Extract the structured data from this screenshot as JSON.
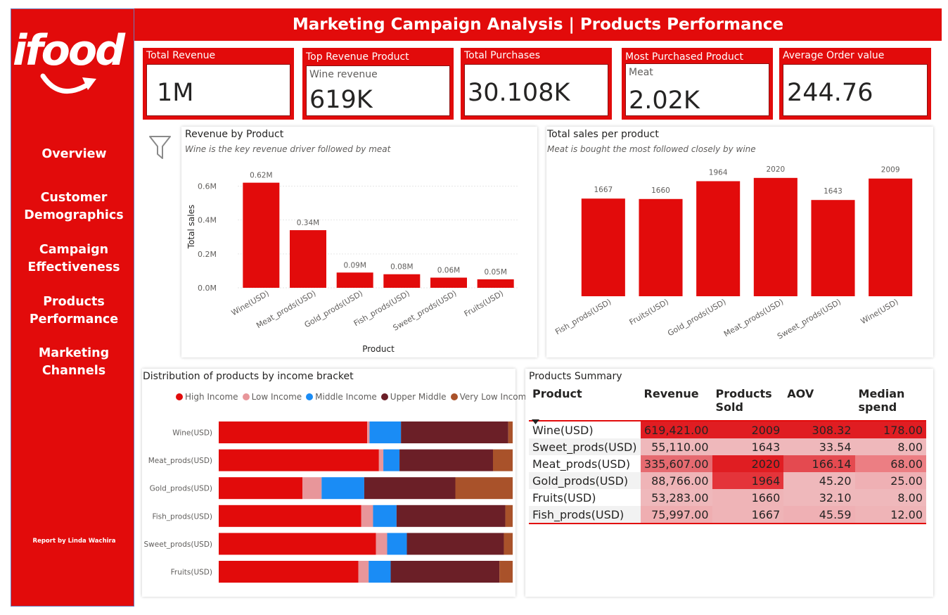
{
  "banner": {
    "title": "Marketing Campaign Analysis | Products Performance"
  },
  "logo": {
    "text": "ifood"
  },
  "nav": {
    "items": [
      {
        "label": "Overview"
      },
      {
        "label": "Customer Demographics"
      },
      {
        "label": "Campaign Effectiveness"
      },
      {
        "label": "Products Performance"
      },
      {
        "label": "Marketing Channels"
      }
    ]
  },
  "credit": "Report by Linda Wachira",
  "kpis": [
    {
      "title": "Total Revenue",
      "value": "1M",
      "sub": ""
    },
    {
      "title": "Top Revenue Product",
      "value": "619K",
      "sub": "Wine revenue"
    },
    {
      "title": "Total Purchases",
      "value": "30.108K",
      "sub": ""
    },
    {
      "title": "Most Purchased Product",
      "value": "2.02K",
      "sub": "Meat"
    },
    {
      "title": "Average Order value",
      "value": "244.76",
      "sub": ""
    }
  ],
  "colors": {
    "brand": "#e20b0b",
    "high": "#e20b0b",
    "low": "#e8969a",
    "middle": "#1a8cf5",
    "upper": "#6b1f27",
    "verylow": "#a9522a"
  },
  "chart_data": [
    {
      "type": "bar",
      "title": "Revenue by Product",
      "subtitle": "Wine is the key revenue driver followed by meat",
      "xlabel": "Product",
      "ylabel": "Total sales",
      "categories": [
        "Wine(USD)",
        "Meat_prods(USD)",
        "Gold_prods(USD)",
        "Fish_prods(USD)",
        "Sweet_prods(USD)",
        "Fruits(USD)"
      ],
      "values": [
        0.62,
        0.34,
        0.09,
        0.08,
        0.06,
        0.05
      ],
      "data_labels": [
        "0.62M",
        "0.34M",
        "0.09M",
        "0.08M",
        "0.06M",
        "0.05M"
      ],
      "yticks": [
        "0.0M",
        "0.2M",
        "0.4M",
        "0.6M"
      ],
      "ytick_values": [
        0,
        0.2,
        0.4,
        0.6
      ],
      "ylim": [
        0,
        0.66
      ],
      "grid": true
    },
    {
      "type": "bar",
      "title": "Total sales per product",
      "subtitle": "Meat is bought the most followed closely by wine",
      "categories": [
        "Fish_prods(USD)",
        "Fruits(USD)",
        "Gold_prods(USD)",
        "Meat_prods(USD)",
        "Sweet_prods(USD)",
        "Wine(USD)"
      ],
      "values": [
        1667,
        1660,
        1964,
        2020,
        1643,
        2009
      ],
      "data_labels": [
        "1667",
        "1660",
        "1964",
        "2020",
        "1643",
        "2009"
      ],
      "ylim": [
        0,
        2150
      ],
      "grid": false
    },
    {
      "type": "bar",
      "orientation": "horizontal-stacked-100",
      "title": "Distribution of products by income bracket",
      "legend_position": "top",
      "categories": [
        "Wine(USD)",
        "Meat_prods(USD)",
        "Gold_prods(USD)",
        "Fish_prods(USD)",
        "Sweet_prods(USD)",
        "Fruits(USD)"
      ],
      "series": [
        {
          "name": "High Income",
          "values": [
            50.5,
            54.5,
            28.5,
            48.5,
            53.5,
            47.5
          ]
        },
        {
          "name": "Low Income",
          "values": [
            0.8,
            1.5,
            6.5,
            4.0,
            3.8,
            3.5
          ]
        },
        {
          "name": "Middle Income",
          "values": [
            10.7,
            5.5,
            14.5,
            8.0,
            6.7,
            7.5
          ]
        },
        {
          "name": "Upper Middle",
          "values": [
            36.5,
            31.8,
            31.0,
            37.0,
            33.0,
            37.0
          ]
        },
        {
          "name": "Very Low Income",
          "values": [
            1.5,
            6.7,
            19.5,
            2.5,
            3.0,
            4.5
          ]
        }
      ]
    },
    {
      "type": "table",
      "title": "Products Summary",
      "columns": [
        "Product",
        "Revenue",
        "Products Sold",
        "AOV",
        "Median spend"
      ],
      "rows": [
        [
          "Wine(USD)",
          "619,421.00",
          "2009",
          "308.32",
          "178.00"
        ],
        [
          "Sweet_prods(USD)",
          "55,110.00",
          "1643",
          "33.54",
          "8.00"
        ],
        [
          "Meat_prods(USD)",
          "335,607.00",
          "2020",
          "166.14",
          "68.00"
        ],
        [
          "Gold_prods(USD)",
          "88,766.00",
          "1964",
          "45.20",
          "25.00"
        ],
        [
          "Fruits(USD)",
          "53,283.00",
          "1660",
          "32.10",
          "8.00"
        ],
        [
          "Fish_prods(USD)",
          "75,997.00",
          "1667",
          "45.59",
          "12.00"
        ]
      ],
      "cell_colors": [
        [
          "#e01d22",
          "#e01d22",
          "#e01d22",
          "#e01d22"
        ],
        [
          "#efb8bb",
          "#efb8bb",
          "#efb8bb",
          "#efb8bb"
        ],
        [
          "#e66a70",
          "#e01d22",
          "#e44a50",
          "#ec7e83"
        ],
        [
          "#efb4b7",
          "#e4343a",
          "#efb8bb",
          "#efb0b4"
        ],
        [
          "#efb8bb",
          "#efb4b7",
          "#efb8bb",
          "#efb8bb"
        ],
        [
          "#efaeb1",
          "#efb4b7",
          "#efb0b4",
          "#efb4b7"
        ]
      ]
    }
  ]
}
